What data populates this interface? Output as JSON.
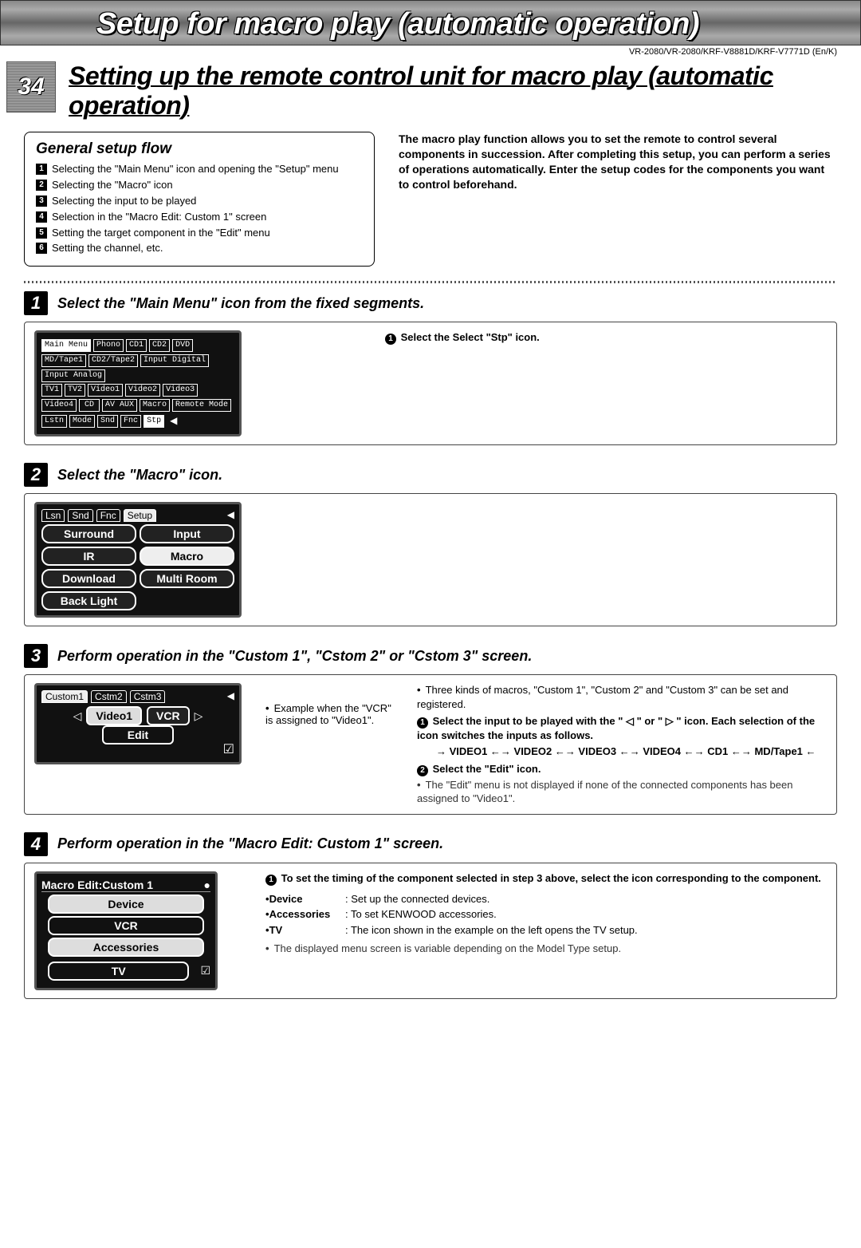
{
  "banner": {
    "title": "Setup for macro play (automatic operation)"
  },
  "models": "VR-2080/VR-2080/KRF-V8881D/KRF-V7771D (En/K)",
  "page_number": "34",
  "main_title": "Setting up the remote control unit for macro play (automatic operation)",
  "flow": {
    "heading": "General setup flow",
    "items": [
      "Selecting the \"Main Menu\" icon and opening the \"Setup\" menu",
      "Selecting the \"Macro\" icon",
      "Selecting the input to be played",
      "Selection in the \"Macro Edit: Custom 1\" screen",
      "Setting the target component in the \"Edit\" menu",
      "Setting the channel, etc."
    ]
  },
  "intro": "The macro play function allows you to set the remote to control several components in succession. After completing this setup, you can perform a series of operations automatically. Enter the setup codes for the components you want to control beforehand.",
  "steps": [
    {
      "num": "1",
      "title": "Select the \"Main Menu\" icon from the fixed segments.",
      "lcd": {
        "row1": [
          "Main Menu",
          "Phono",
          "CD1",
          "CD2",
          "DVD",
          "MD/Tape1",
          "CD2/Tape2",
          "Input Digital",
          "Input Analog"
        ],
        "row2": [
          "TV1",
          "TV2",
          "Video1",
          "Video2",
          "Video3",
          "Video4",
          "CD",
          "AV AUX",
          "Macro",
          "Remote Mode"
        ],
        "tabs": [
          "Lstn",
          "Mode",
          "Snd",
          "Fnc",
          "Stp"
        ]
      },
      "right_bullet": "Select the Select \"Stp\" icon."
    },
    {
      "num": "2",
      "title": "Select the \"Macro\" icon.",
      "lcd": {
        "tabs": [
          "Lsn",
          "Snd",
          "Fnc",
          "Setup"
        ],
        "cells": [
          [
            "Surround",
            "Input"
          ],
          [
            "IR",
            "Macro"
          ],
          [
            "Download",
            "Multi Room"
          ],
          [
            "Back Light",
            ""
          ]
        ]
      }
    },
    {
      "num": "3",
      "title": "Perform operation in the \"Custom 1\", \"Cstom 2\" or \"Cstom 3\" screen.",
      "lcd": {
        "tabs": [
          "Custom1",
          "Cstm2",
          "Cstm3"
        ],
        "input": "Video1",
        "device": "VCR",
        "edit": "Edit"
      },
      "mid_note": "Example when the \"VCR\" is assigned to \"Video1\".",
      "right": {
        "line1": "Three kinds of macros, \"Custom 1\", \"Custom 2\" and \"Custom 3\" can be set and registered.",
        "bullet1": "Select the input to be played with the \" ◁ \" or \" ▷ \" icon. Each selection of the icon switches the inputs as follows.",
        "sequence": "→ VIDEO1 ←→ VIDEO2 ←→ VIDEO3 ←→ VIDEO4 ←→ CD1 ←→ MD/Tape1 ←",
        "bullet2": "Select the \"Edit\" icon.",
        "line2": "The \"Edit\" menu is not displayed if none of the connected components has been assigned to \"Video1\"."
      }
    },
    {
      "num": "4",
      "title": "Perform operation in the \"Macro Edit: Custom 1\" screen.",
      "lcd": {
        "header": "Macro Edit:Custom 1",
        "items": [
          "Device",
          "VCR",
          "Accessories",
          "TV"
        ]
      },
      "right": {
        "lead": "To set the timing of the component selected in step 3 above, select the icon corresponding to the component.",
        "defs": [
          {
            "term": "Device",
            "desc": ": Set up the connected devices."
          },
          {
            "term": "Accessories",
            "desc": ": To set KENWOOD accessories."
          },
          {
            "term": "TV",
            "desc": ": The icon shown in the example on the left opens the TV setup."
          }
        ],
        "note": "The displayed menu screen is variable depending on the Model Type setup."
      }
    }
  ]
}
